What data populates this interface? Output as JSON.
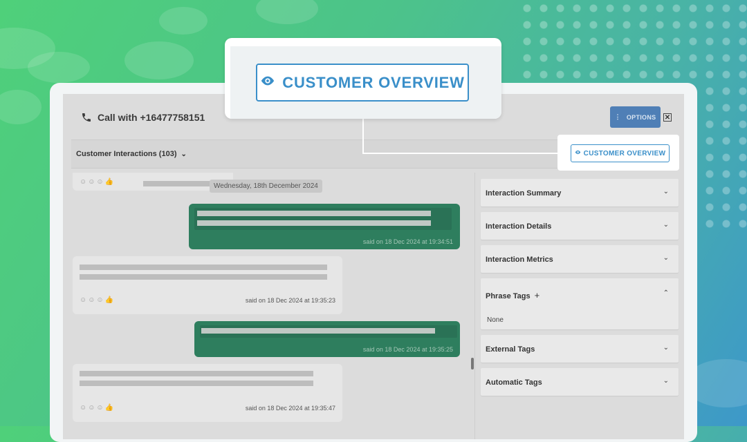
{
  "header": {
    "title": "Call with +16477758151",
    "options_label": "OPTIONS",
    "close_label": "✕"
  },
  "toolbar": {
    "interactions_label": "Customer Interactions (103)",
    "customer_overview_label": "CUSTOMER OVERVIEW"
  },
  "callout": {
    "customer_overview_label": "CUSTOMER OVERVIEW"
  },
  "chat": {
    "date_chip": "Wednesday, 18th December 2024",
    "messages": [
      {
        "said": "said on 18 Dec 2024 at 19:34:51"
      },
      {
        "said": "said on 18 Dec 2024 at 19:35:23"
      },
      {
        "said": "said on 18 Dec 2024 at 19:35:25"
      },
      {
        "said": "said on 18 Dec 2024 at 19:35:47"
      }
    ]
  },
  "sidebar": {
    "sections": [
      {
        "title": "Interaction Summary"
      },
      {
        "title": "Interaction Details"
      },
      {
        "title": "Interaction Metrics"
      },
      {
        "title": "Phrase Tags",
        "body": "None"
      },
      {
        "title": "External Tags"
      },
      {
        "title": "Automatic Tags"
      }
    ]
  },
  "colors": {
    "accent_blue": "#3a8fc9",
    "options_button": "#4f7fb6",
    "outgoing_bubble": "#2e7e5e"
  },
  "icons": [
    "phone-icon",
    "eye-icon",
    "kebab-icon",
    "close-icon",
    "chevron-down-icon",
    "chevron-up-icon",
    "plus-icon",
    "reaction-icon"
  ]
}
